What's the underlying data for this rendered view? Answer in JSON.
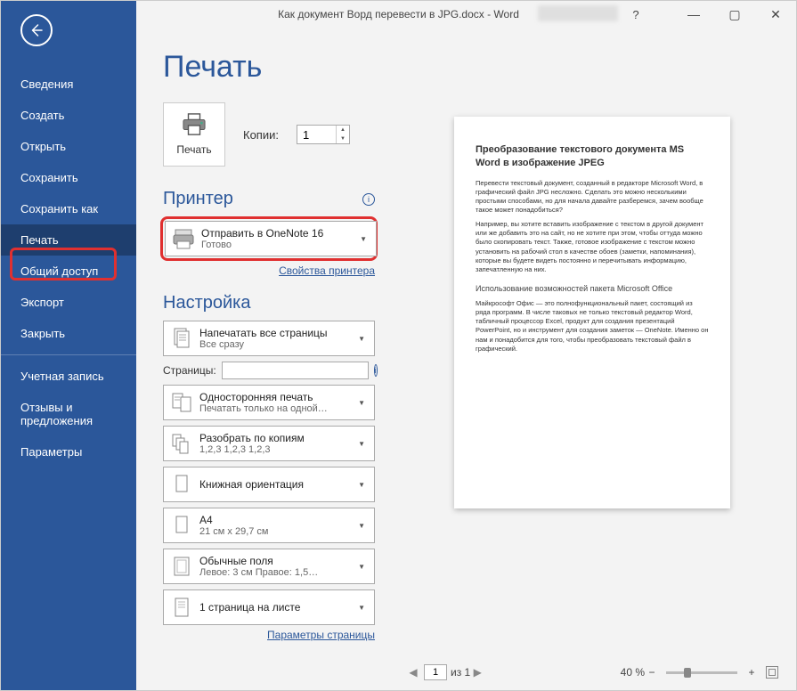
{
  "window": {
    "title": "Как документ Ворд перевести в JPG.docx  -  Word",
    "help": "?",
    "minimize": "—",
    "maximize": "▢",
    "close": "✕"
  },
  "sidebar": {
    "items": [
      {
        "label": "Сведения"
      },
      {
        "label": "Создать"
      },
      {
        "label": "Открыть"
      },
      {
        "label": "Сохранить"
      },
      {
        "label": "Сохранить как"
      },
      {
        "label": "Печать",
        "active": true
      },
      {
        "label": "Общий доступ"
      },
      {
        "label": "Экспорт"
      },
      {
        "label": "Закрыть"
      }
    ],
    "footer": [
      {
        "label": "Учетная запись"
      },
      {
        "label": "Отзывы и предложения"
      },
      {
        "label": "Параметры"
      }
    ]
  },
  "main": {
    "heading": "Печать",
    "printButton": "Печать",
    "copiesLabel": "Копии:",
    "copiesValue": "1",
    "printerHeading": "Принтер",
    "printer": {
      "name": "Отправить в OneNote 16",
      "status": "Готово"
    },
    "printerProps": "Свойства принтера",
    "settingsHeading": "Настройка",
    "settings": [
      {
        "primary": "Напечатать все страницы",
        "secondary": "Все сразу",
        "icon": "pages"
      },
      {
        "primary": "Односторонняя печать",
        "secondary": "Печатать только на одной…",
        "icon": "one-side"
      },
      {
        "primary": "Разобрать по копиям",
        "secondary": "1,2,3    1,2,3    1,2,3",
        "icon": "collate"
      },
      {
        "primary": "Книжная ориентация",
        "secondary": "",
        "icon": "portrait"
      },
      {
        "primary": "A4",
        "secondary": "21 см x 29,7 см",
        "icon": "size"
      },
      {
        "primary": "Обычные поля",
        "secondary": "Левое:  3 см   Правое:  1,5…",
        "icon": "margins"
      },
      {
        "primary": "1 страница на листе",
        "secondary": "",
        "icon": "one-per"
      }
    ],
    "pagesLabel": "Страницы:",
    "pageSetup": "Параметры страницы"
  },
  "preview": {
    "title": "Преобразование текстового документа MS Word в изображение JPEG",
    "p1": "Перевести текстовый документ, созданный в редакторе Microsoft Word, в графический файл JPG несложно. Сделать это можно несколькими простыми способами, но для начала давайте разберемся, зачем вообще такое может понадобиться?",
    "p2": "Например, вы хотите вставить изображение с текстом в другой документ или же добавить это на сайт, но не хотите при этом, чтобы оттуда можно было скопировать текст. Также, готовое изображение с текстом можно установить на рабочий стол в качестве обоев (заметки, напоминания), которые вы будете видеть постоянно и перечитывать информацию, запечатленную на них.",
    "h3": "Использование возможностей пакета Microsoft Office",
    "p3": "Майкрософт Офис — это полнофункциональный пакет, состоящий из ряда программ. В числе таковых не только текстовый редактор Word, табличный процессор Excel, продукт для создания презентаций PowerPoint, но и инструмент для создания заметок — OneNote. Именно он нам и понадобится для того, чтобы преобразовать текстовый файл в графический."
  },
  "bottombar": {
    "page": "1",
    "pageOf": "из 1",
    "zoom": "40 %"
  }
}
